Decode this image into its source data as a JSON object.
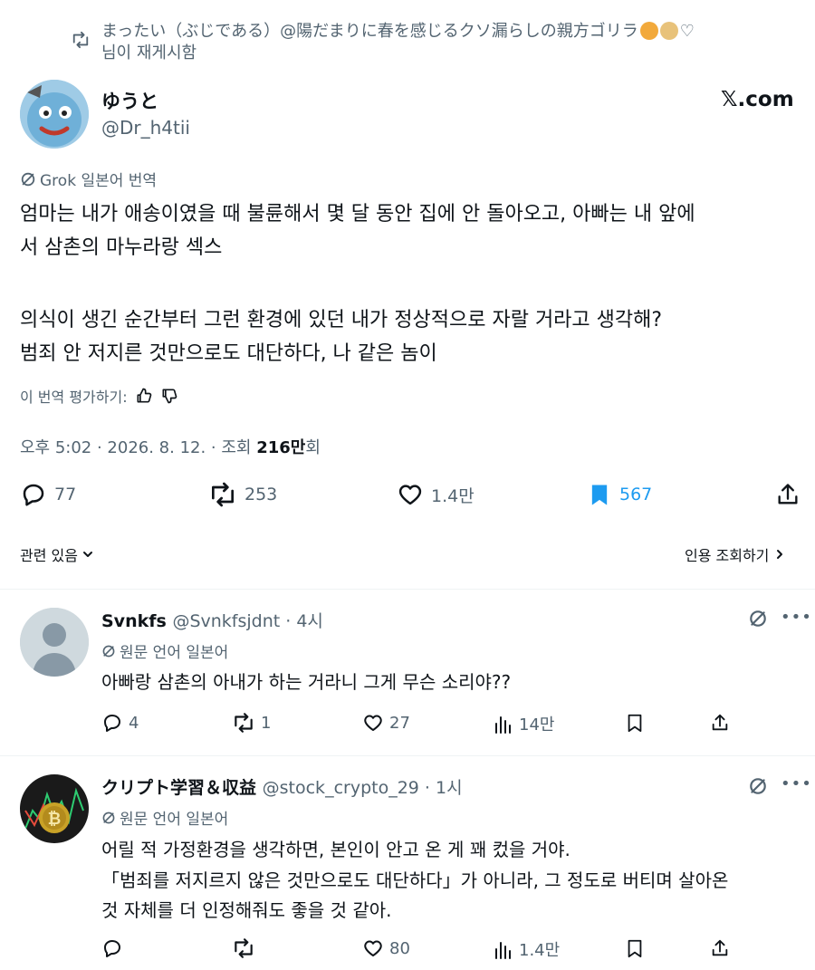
{
  "repost": {
    "line1": "まったい（ぶじである）@陽だまりに春を感じるクソ漏らしの親方ゴリラ",
    "line2": "님이 재게시함"
  },
  "tweet": {
    "author_name": "ゆうと",
    "author_handle": "@Dr_h4tii",
    "brand": "𝕏.com",
    "translation_label": "Grok 일본어 번역",
    "body_lines": [
      "엄마는 내가 애송이였을 때 불륜해서 몇 달 동안 집에 안 돌아오고, 아빠는 내 앞에",
      "서 삼촌의 마누라랑 섹스",
      "의식이 생긴 순간부터 그런 환경에 있던 내가 정상적으로 자랄 거라고 생각해?",
      "범죄 안 저지른 것만으로도 대단하다, 나 같은 놈이"
    ],
    "rate_label": "이 번역 평가하기:",
    "meta_prefix": "오후 5:02 · 2026. 8. 12. · 조회 ",
    "meta_views": "216만",
    "meta_suffix": "회",
    "stats": {
      "replies": "77",
      "reposts": "253",
      "likes": "1.4만",
      "bookmarks": "567"
    },
    "bookmark_color": "#1d9bf0",
    "related_label": "관련 있음",
    "quotes_label": "인용 조회하기"
  },
  "replies": [
    {
      "name": "Svnkfs",
      "handle": "@Svnkfsjdnt · 4시",
      "label": "원문 언어 일본어",
      "text_lines": [
        "아빠랑 삼촌의 아내가 하는 거라니 그게 무슨 소리야??"
      ],
      "replies": "4",
      "reposts": "1",
      "likes": "27",
      "views": "14만"
    },
    {
      "name": "クリプト学習＆収益",
      "handle": "@stock_crypto_29 · 1시",
      "label": "원문 언어 일본어",
      "text_lines": [
        "어릴 적 가정환경을 생각하면, 본인이 안고 온 게 꽤 컸을 거야.",
        "「범죄를 저지르지 않은 것만으로도 대단하다」가 아니라, 그 정도로 버티며 살아온",
        "것 자체를 더 인정해줘도 좋을 것 같아."
      ],
      "replies": "",
      "reposts": "",
      "likes": "80",
      "views": "1.4만"
    }
  ]
}
